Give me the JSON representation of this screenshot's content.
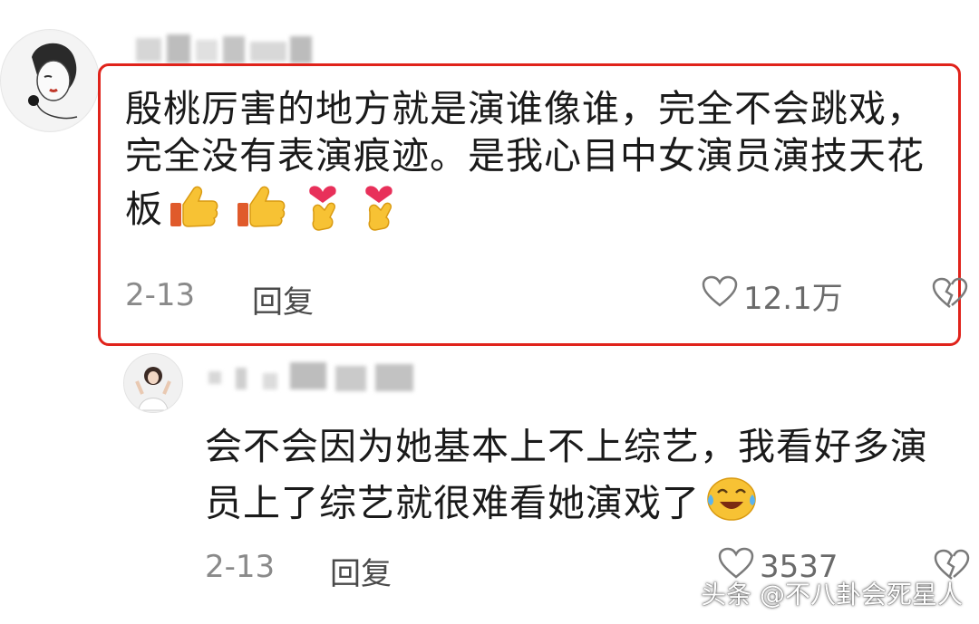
{
  "comments": [
    {
      "text": "殷桃厉害的地方就是演谁像谁，完全不会跳戏，完全没有表演痕迹。是我心目中女演员演技天花板",
      "emojis": [
        "thumbs-up",
        "thumbs-up",
        "heart-hand",
        "heart-hand"
      ],
      "date": "2-13",
      "reply_label": "回复",
      "likes": "12.1万"
    },
    {
      "text": "会不会因为她基本上不上综艺，我看好多演员上了综艺就很难看她演戏了",
      "emojis": [
        "crying-laughing-face"
      ],
      "date": "2-13",
      "reply_label": "回复",
      "likes": "3537"
    }
  ],
  "watermark": "头条 @不八卦会死星人",
  "colors": {
    "highlight_border": "#e0231b",
    "meta_gray": "#8a8a8a",
    "text": "#1a1a1a"
  }
}
